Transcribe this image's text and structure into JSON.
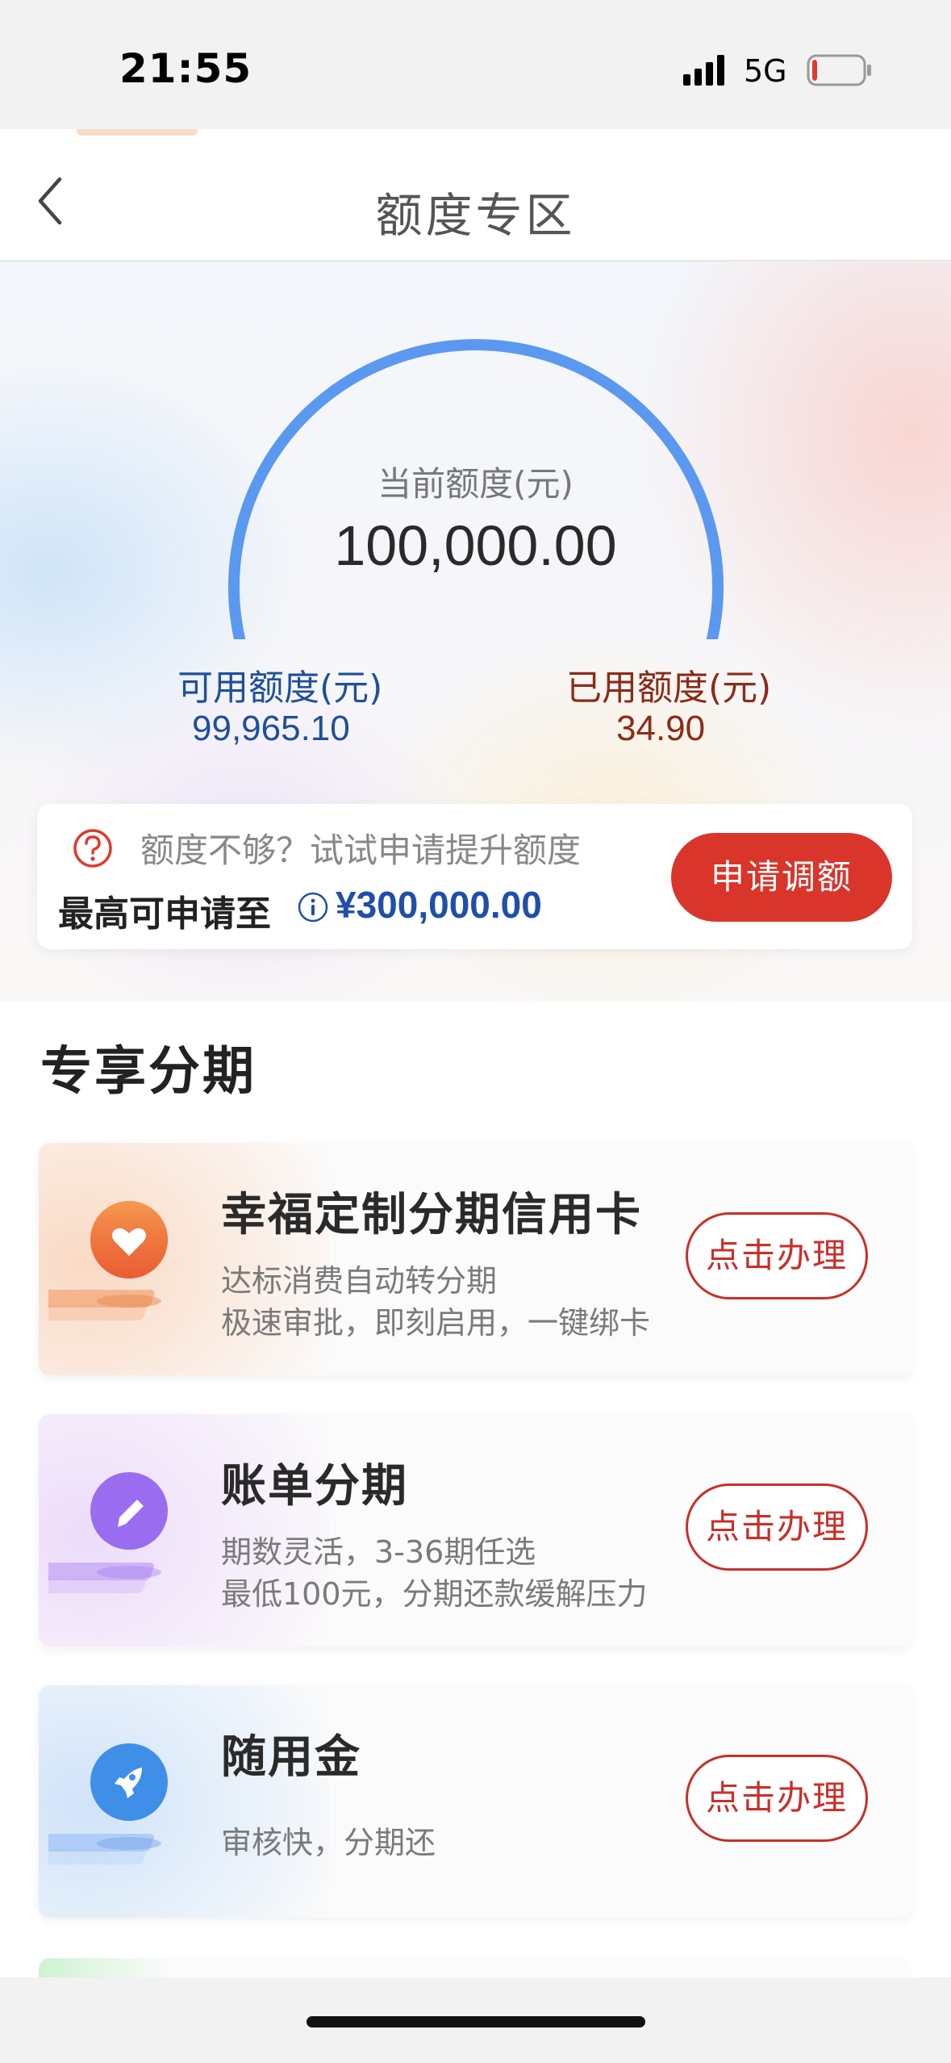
{
  "status_bar": {
    "time": "21:55",
    "network": "5G",
    "battery_level": 0.1,
    "battery_color": "#e0392b"
  },
  "nav": {
    "title": "额度专区",
    "back_icon": "chevron-left-icon"
  },
  "credit": {
    "caption": "当前额度(元)",
    "total": "100,000.00",
    "available_label": "可用额度(元)",
    "available_value": "99,965.10",
    "used_label": "已用额度(元)",
    "used_value": "34.90",
    "gauge_color": "#5b98f0"
  },
  "promo": {
    "hint": "额度不够？试试申请提升额度",
    "max_label": "最高可申请至",
    "max_value": "¥300,000.00",
    "apply_label": "申请调额"
  },
  "section": {
    "title": "专享分期"
  },
  "products": [
    {
      "title": "幸福定制分期信用卡",
      "desc_lines": [
        "达标消费自动转分期",
        "极速审批，即刻启用，一键绑卡"
      ],
      "button": "点击办理",
      "icon": "heart-icon",
      "accent": "#f07a3c"
    },
    {
      "title": "账单分期",
      "desc_lines": [
        "期数灵活，3-36期任选",
        "最低100元，分期还款缓解压力"
      ],
      "button": "点击办理",
      "icon": "pencil-icon",
      "accent": "#9a6cf0"
    },
    {
      "title": "随用金",
      "desc_lines": [
        "审核快，分期还"
      ],
      "button": "点击办理",
      "icon": "rocket-icon",
      "accent": "#3f8fe8"
    }
  ]
}
